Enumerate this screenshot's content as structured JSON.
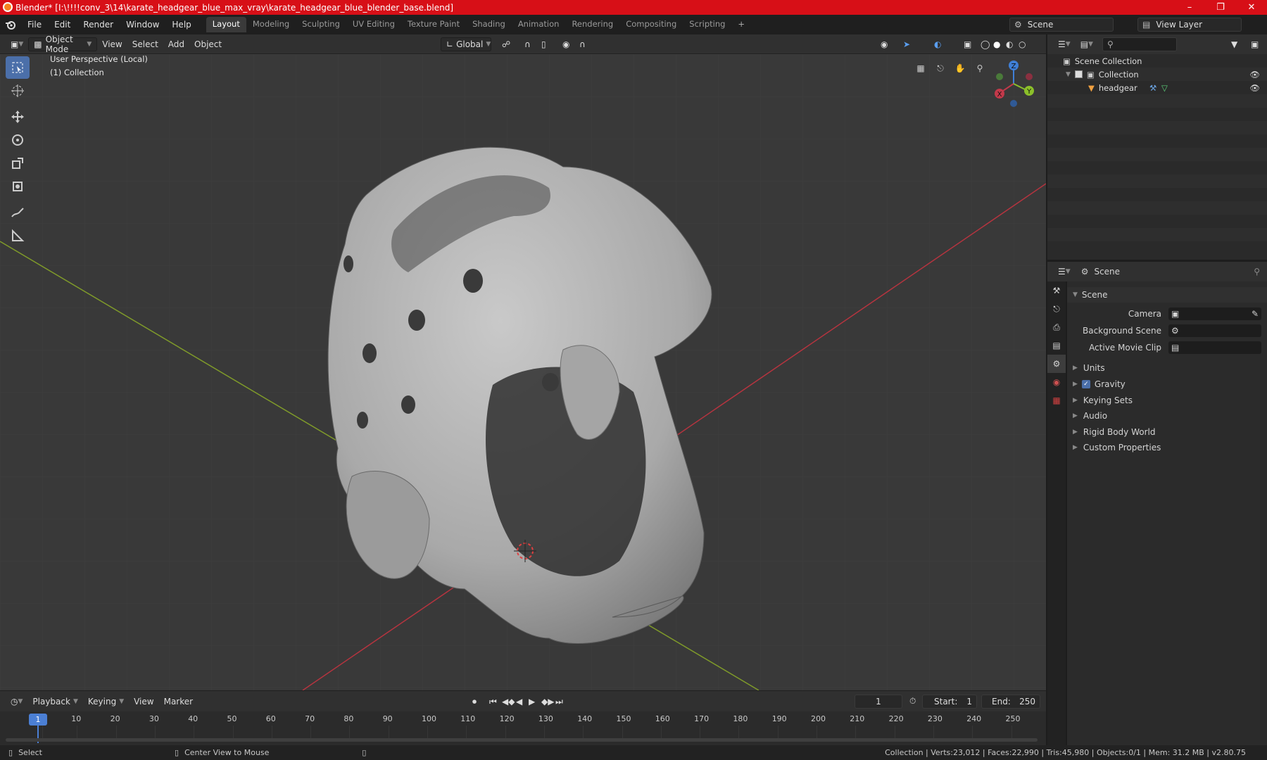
{
  "window": {
    "title": "Blender* [I:\\!!!!conv_3\\14\\karate_headgear_blue_max_vray\\karate_headgear_blue_blender_base.blend]"
  },
  "menu": [
    "File",
    "Edit",
    "Render",
    "Window",
    "Help"
  ],
  "workspaces": [
    "Layout",
    "Modeling",
    "Sculpting",
    "UV Editing",
    "Texture Paint",
    "Shading",
    "Animation",
    "Rendering",
    "Compositing",
    "Scripting"
  ],
  "scene_selector": "Scene",
  "view_layer": "View Layer",
  "viewport_header": {
    "mode": "Object Mode",
    "menus": [
      "View",
      "Select",
      "Add",
      "Object"
    ],
    "orientation": "Global"
  },
  "viewport": {
    "perspective": "User Perspective (Local)",
    "collection": "(1) Collection"
  },
  "gizmo": {
    "x": "X",
    "y": "Y",
    "z": "Z"
  },
  "outliner": {
    "root": "Scene Collection",
    "collection": "Collection",
    "object": "headgear"
  },
  "properties": {
    "context": "Scene",
    "panel": "Scene",
    "fields": [
      {
        "label": "Camera"
      },
      {
        "label": "Background Scene"
      },
      {
        "label": "Active Movie Clip"
      }
    ],
    "sections": [
      "Units",
      "Gravity",
      "Keying Sets",
      "Audio",
      "Rigid Body World",
      "Custom Properties"
    ]
  },
  "timeline": {
    "menus": [
      "Playback",
      "Keying",
      "View",
      "Marker"
    ],
    "current_frame": "1",
    "start_label": "Start:",
    "start": "1",
    "end_label": "End:",
    "end": "250",
    "ticks": [
      "1",
      "10",
      "20",
      "30",
      "40",
      "50",
      "60",
      "70",
      "80",
      "90",
      "100",
      "110",
      "120",
      "130",
      "140",
      "150",
      "160",
      "170",
      "180",
      "190",
      "200",
      "210",
      "220",
      "230",
      "240",
      "250"
    ]
  },
  "statusbar": {
    "select": "Select",
    "center": "Center View to Mouse",
    "stats": "Collection | Verts:23,012 | Faces:22,990 | Tris:45,980 | Objects:0/1 | Mem: 31.2 MB | v2.80.75"
  },
  "colors": {
    "accent": "#4b6fa9",
    "title_bar": "#d70f17",
    "x_axis": "#c2394a",
    "y_axis": "#8bbf2a",
    "z_axis": "#3f7fd6"
  },
  "icons": [
    "blender-logo",
    "select-box-icon",
    "cursor-icon",
    "move-icon",
    "rotate-icon",
    "scale-icon",
    "transform-icon",
    "annotate-icon",
    "measure-icon",
    "eye-icon",
    "wrench-icon",
    "mesh-icon",
    "play-icon",
    "record-icon"
  ]
}
